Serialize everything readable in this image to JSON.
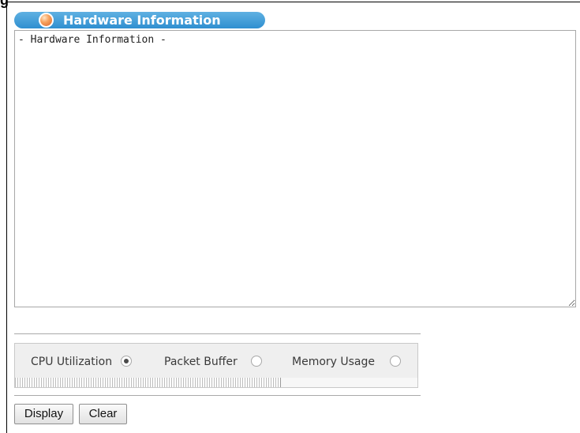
{
  "panel": {
    "title": "Hardware Information",
    "output_text": "- Hardware Information -"
  },
  "monitor": {
    "options": [
      {
        "label": "CPU Utilization",
        "checked": true
      },
      {
        "label": "Packet Buffer",
        "checked": false
      },
      {
        "label": "Memory Usage",
        "checked": false
      }
    ],
    "progress_fraction": 0.66
  },
  "buttons": {
    "display_label": "Display",
    "clear_label": "Clear"
  },
  "colors": {
    "title_bar": "#3b9ad9",
    "title_ball": "#f59a52",
    "panel_bg": "#efefef"
  }
}
